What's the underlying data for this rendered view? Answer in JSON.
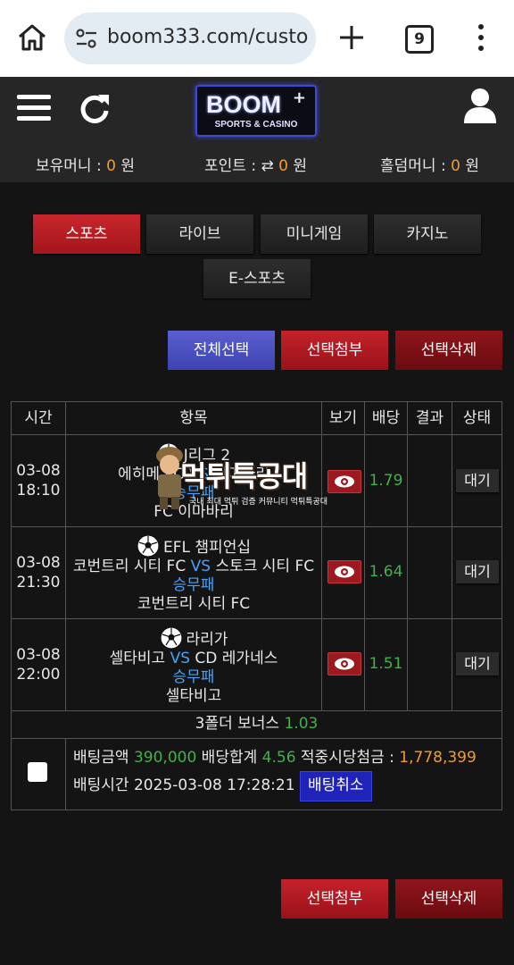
{
  "browser": {
    "url": "boom333.com/custo",
    "tab_count": "9"
  },
  "header": {
    "logo_main": "BOOM",
    "logo_plus": "+",
    "logo_sub": "SPORTS & CASINO",
    "balance": {
      "label": "보유머니 : ",
      "value": "0",
      "unit": " 원"
    },
    "points": {
      "label": "포인트 : ",
      "arrow": "⇄ ",
      "value": "0",
      "unit": " 원"
    },
    "holdem": {
      "label": "홀덤머니 : ",
      "value": "0",
      "unit": " 원"
    }
  },
  "tabs": {
    "sports": "스포츠",
    "live": "라이브",
    "mini": "미니게임",
    "casino": "카지노",
    "esports": "E-스포츠"
  },
  "actions": {
    "select_all": "전체선택",
    "attach": "선택첨부",
    "delete": "선택삭제"
  },
  "table": {
    "headers": {
      "time": "시간",
      "item": "항목",
      "view": "보기",
      "odds": "배당",
      "result": "결과",
      "status": "상태"
    },
    "rows": [
      {
        "date": "03-08",
        "time": "18:10",
        "league": "J리그 2",
        "home": "에히메 FC",
        "vs": "VS",
        "away": "이마바리",
        "market": "승무패",
        "pick": "FC 이마바리",
        "odds": "1.79",
        "status": "대기"
      },
      {
        "date": "03-08",
        "time": "21:30",
        "league": "EFL 챔피언십",
        "home": "코번트리 시티 FC",
        "vs": "VS",
        "away": "스토크 시티 FC",
        "market": "승무패",
        "pick": "코번트리 시티 FC",
        "odds": "1.64",
        "status": "대기"
      },
      {
        "date": "03-08",
        "time": "22:00",
        "league": "라리가",
        "home": "셀타비고",
        "vs": "VS",
        "away": "CD 레가네스",
        "market": "승무패",
        "pick": "셀타비고",
        "odds": "1.51",
        "status": "대기"
      }
    ],
    "bonus": {
      "label": "3폴더 보너스 ",
      "value": "1.03"
    },
    "summary": {
      "amount_label": "배팅금액 ",
      "amount": "390,000",
      "total_label": " 배당합계 ",
      "total": "4.56",
      "payout_label": " 적중시당첨금 : ",
      "payout": "1,778,399",
      "time_label": "배팅시간 ",
      "time": "2025-03-08 17:28:21",
      "cancel": "배팅취소"
    }
  },
  "watermark": {
    "title": "먹튀특공대",
    "tagline": "국내 최대 먹튀 검증 커뮤니티 먹튀특공대"
  }
}
